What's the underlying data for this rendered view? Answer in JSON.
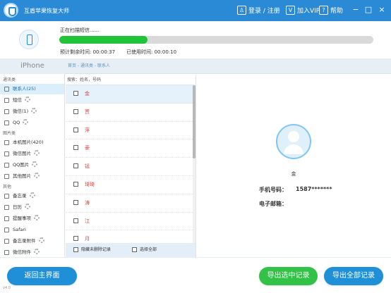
{
  "window": {
    "title": "互盾苹果恢复大师",
    "login": "登录 / 注册",
    "vip": "加入VIP",
    "help": "帮助",
    "minimize": "−",
    "maximize": "□",
    "close": "×"
  },
  "progress": {
    "status": "正在扫描短信......",
    "percent": 28,
    "remaining_label": "预计剩余时间:",
    "remaining": "00:00:37",
    "used_label": "已使用时间:",
    "used": "00:00:10"
  },
  "sidebar": {
    "device": "iPhone",
    "categories": [
      "通讯类",
      "图片类",
      "其他"
    ],
    "items": [
      {
        "label": "联系人(25)"
      },
      {
        "label": "短信"
      },
      {
        "label": "微信(1)"
      },
      {
        "label": "QQ"
      },
      {
        "label": "本机图片(420)"
      },
      {
        "label": "微信图片"
      },
      {
        "label": "QQ图片"
      },
      {
        "label": "其他图片"
      },
      {
        "label": "备忘录"
      },
      {
        "label": "日历"
      },
      {
        "label": "提醒事项"
      },
      {
        "label": "Safari"
      },
      {
        "label": "备忘录附件"
      },
      {
        "label": "微信附件"
      }
    ]
  },
  "breadcrumb": "首页 - 通讯类 - 联系人",
  "search": {
    "placeholder": "搜索：姓名，号码"
  },
  "contacts": [
    {
      "name": "金"
    },
    {
      "name": "贾"
    },
    {
      "name": "萍"
    },
    {
      "name": "豪"
    },
    {
      "name": "锰"
    },
    {
      "name": "琦琦"
    },
    {
      "name": "涛"
    },
    {
      "name": "江"
    },
    {
      "name": "月"
    },
    {
      "name": "瑞"
    }
  ],
  "list_footer": {
    "hide_deleted": "隐藏未删除记录",
    "select_all": "选择全部"
  },
  "detail": {
    "name": "金",
    "phone_label": "手机号码：",
    "phone": "1587*******",
    "email_label": "电子邮箱："
  },
  "buttons": {
    "back": "返回主界面",
    "export_selected": "导出选中记录",
    "export_all": "导出全部记录"
  },
  "version": "v4.0",
  "colors": {
    "titlebar": "#2a8ad6",
    "progress": "#21c33b",
    "primary": "#1f90d8",
    "success": "#31c247",
    "contact_name": "#e0463b"
  },
  "icons": [
    "shield-icon",
    "user-icon",
    "vip-icon",
    "help-icon",
    "phone-icon",
    "contact-icon",
    "sms-icon",
    "wechat-icon",
    "qq-icon",
    "image-icon",
    "memo-icon",
    "calendar-icon",
    "reminder-icon",
    "safari-icon",
    "attachment-icon"
  ]
}
